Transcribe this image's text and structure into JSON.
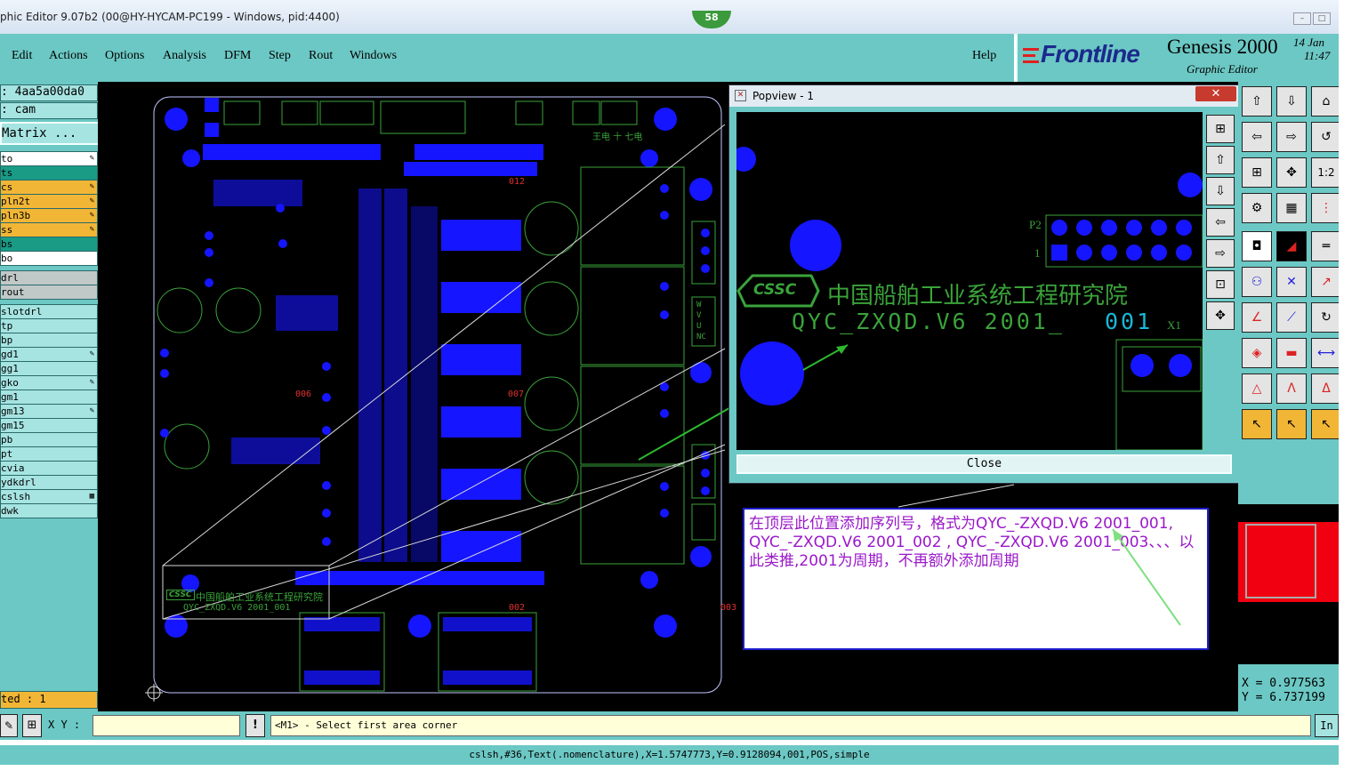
{
  "window": {
    "title": "phic Editor 9.07b2 (00@HY-HYCAM-PC199 - Windows, pid:4400)",
    "badge": "58"
  },
  "menu": {
    "items": [
      "Edit",
      "Actions",
      "Options",
      "Analysis",
      "DFM",
      "Step",
      "Rout",
      "Windows"
    ],
    "help": "Help"
  },
  "brand": {
    "logo_text": "Frontline",
    "product": "Genesis 2000",
    "subtitle": "Graphic Editor",
    "date": "14 Jan",
    "time": "11:47"
  },
  "left_panel": {
    "job_id": ": 4aa5a00da0",
    "step": ": cam",
    "matrix_button": "Matrix ...",
    "layers": [
      {
        "name": "to",
        "color": "#ffffff",
        "flag": "✎"
      },
      {
        "name": "ts",
        "color": "#1a9b86",
        "flag": ""
      },
      {
        "name": "cs",
        "color": "#f2b636",
        "flag": "✎"
      },
      {
        "name": "pln2t",
        "color": "#f2b636",
        "flag": "✎"
      },
      {
        "name": "pln3b",
        "color": "#f2b636",
        "flag": "✎"
      },
      {
        "name": "ss",
        "color": "#f2b636",
        "flag": "✎"
      },
      {
        "name": "bs",
        "color": "#1a9b86",
        "flag": ""
      },
      {
        "name": "bo",
        "color": "#ffffff",
        "flag": ""
      },
      {
        "name": "drl",
        "color": "#c0c8c8",
        "flag": ""
      },
      {
        "name": "rout",
        "color": "#c0c8c8",
        "flag": ""
      },
      {
        "name": "slotdrl",
        "color": "#a6e4e2",
        "flag": ""
      },
      {
        "name": "tp",
        "color": "#a6e4e2",
        "flag": ""
      },
      {
        "name": "bp",
        "color": "#a6e4e2",
        "flag": ""
      },
      {
        "name": "gd1",
        "color": "#a6e4e2",
        "flag": "✎"
      },
      {
        "name": "gg1",
        "color": "#a6e4e2",
        "flag": ""
      },
      {
        "name": "gko",
        "color": "#a6e4e2",
        "flag": "✎"
      },
      {
        "name": "gm1",
        "color": "#a6e4e2",
        "flag": ""
      },
      {
        "name": "gm13",
        "color": "#a6e4e2",
        "flag": "✎"
      },
      {
        "name": "gm15",
        "color": "#a6e4e2",
        "flag": ""
      },
      {
        "name": "pb",
        "color": "#a6e4e2",
        "flag": ""
      },
      {
        "name": "pt",
        "color": "#a6e4e2",
        "flag": ""
      },
      {
        "name": "cvia",
        "color": "#a6e4e2",
        "flag": ""
      },
      {
        "name": "ydkdrl",
        "color": "#a6e4e2",
        "flag": ""
      },
      {
        "name": "cslsh",
        "color": "#a6e4e2",
        "flag": "▦"
      },
      {
        "name": "dwk",
        "color": "#a6e4e2",
        "flag": ""
      }
    ],
    "selected": "ted : 1"
  },
  "board": {
    "labels": {
      "l012": "012",
      "l006": "006",
      "l007": "007",
      "l002": "002",
      "l003": "003"
    },
    "silk_cn": "中国船舶工业系统工程研究院",
    "silk_code": "QYC_ZXQD.V6 2001_001",
    "silk_logo": "CSSC",
    "silk_small": "王电 十 七电",
    "connector_labels": "W V U NC"
  },
  "popview": {
    "title": "Popview - 1",
    "logo": "CSSC",
    "chinese_text": "中国船舶工业系统工程研究院",
    "code_prefix": "QYC_ZXQD.V6 2001_",
    "code_suffix": "001",
    "p2": "P2",
    "one": "1",
    "x1": "X1",
    "close_label": "Close"
  },
  "note": {
    "text": "在顶层此位置添加序列号，格式为QYC_-ZXQD.V6 2001_001, QYC_-ZXQD.V6 2001_002 , QYC_-ZXQD.V6 2001_003、、、以此类推,2001为周期，不再额外添加周期"
  },
  "coords": {
    "x": "X = 0.977563",
    "y": "Y = 6.737199"
  },
  "command": {
    "xy_label": "X Y :",
    "xy_value": "",
    "prompt": "<M1> - Select first area corner",
    "right_btn": "In"
  },
  "status": {
    "text": "cslsh,#36,Text(.nomenclature),X=1.5747773,Y=0.9128094,001,POS,simple"
  }
}
